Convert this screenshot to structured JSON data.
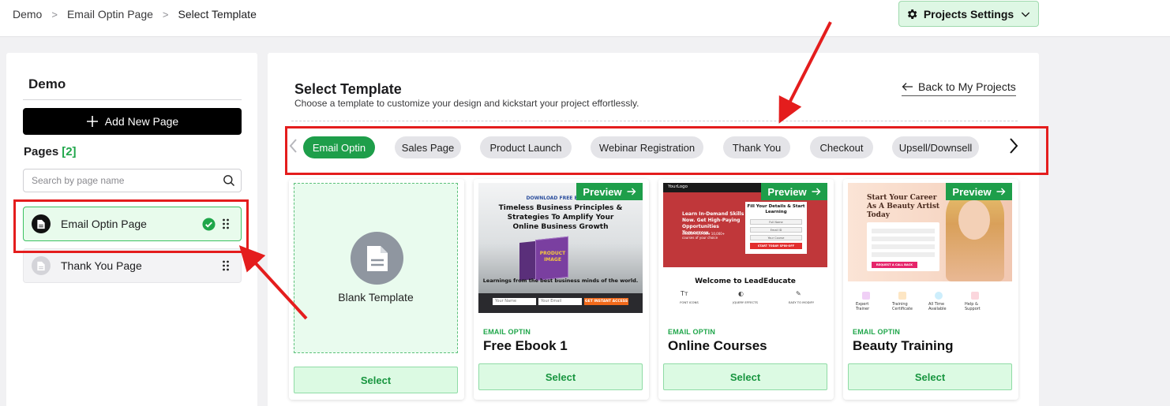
{
  "breadcrumb": [
    "Demo",
    "Email Optin Page",
    "Select Template"
  ],
  "project_settings": {
    "label": "Projects Settings"
  },
  "sidebar": {
    "title": "Demo",
    "add_page_label": "Add New Page",
    "pages_heading": "Pages",
    "pages_count": "[2]",
    "search_placeholder": "Search by page name",
    "pages": [
      {
        "label": "Email Optin Page",
        "active": true
      },
      {
        "label": "Thank You Page",
        "active": false
      }
    ]
  },
  "main": {
    "title": "Select Template",
    "subtitle": "Choose a template to customize your design and kickstart your project effortlessly.",
    "back_link": "Back to My Projects",
    "categories": [
      "Email Optin",
      "Sales Page",
      "Product Launch",
      "Webinar Registration",
      "Thank You",
      "Checkout",
      "Upsell/Downsell"
    ],
    "selected_category": "Email Optin",
    "blank_template_label": "Blank Template",
    "select_label": "Select",
    "preview_label": "Preview",
    "templates": [
      {
        "category": "EMAIL OPTIN",
        "name": "Free Ebook 1",
        "thumb": {
          "kicker": "DOWNLOAD FREE E-BOOK",
          "headline": "Timeless Business Principles & Strategies To Amplify Your Online Business Growth",
          "book": "PRODUCT IMAGE",
          "tagline": "Learnings from the best business minds of the world.",
          "field1": "Your Name",
          "field2": "Your Email",
          "cta": "GET INSTANT ACCESS"
        }
      },
      {
        "category": "EMAIL OPTIN",
        "name": "Online Courses",
        "thumb": {
          "logo": "YourLogo",
          "hero": "Learn In-Demand Skills Now. Get High-Paying Opportunities Tomorrow.",
          "hero_small": "Choose from over 10,000+ courses of your choice",
          "form_title": "Fill Your Details & Start Learning",
          "field1": "Full Name",
          "field2": "Email ID",
          "field3": "Your Course",
          "cta": "START TODAY SPIN-OFF",
          "welcome": "Welcome to LeadEducate",
          "features": [
            "FONT ICONS",
            "JQUERY EFFECTS",
            "EASY TO MODIFY"
          ]
        }
      },
      {
        "category": "EMAIL OPTIN",
        "name": "Beauty Training",
        "thumb": {
          "headline": "Start Your Career As A Beauty Artist Today",
          "cta": "REQUEST A CALL BACK",
          "features": [
            "Expert Trainer",
            "Training Certificate",
            "All Time Available",
            "Help & Support"
          ]
        }
      }
    ]
  },
  "colors": {
    "accent_green": "#1e9e4a",
    "highlight_red": "#e41d1d"
  }
}
